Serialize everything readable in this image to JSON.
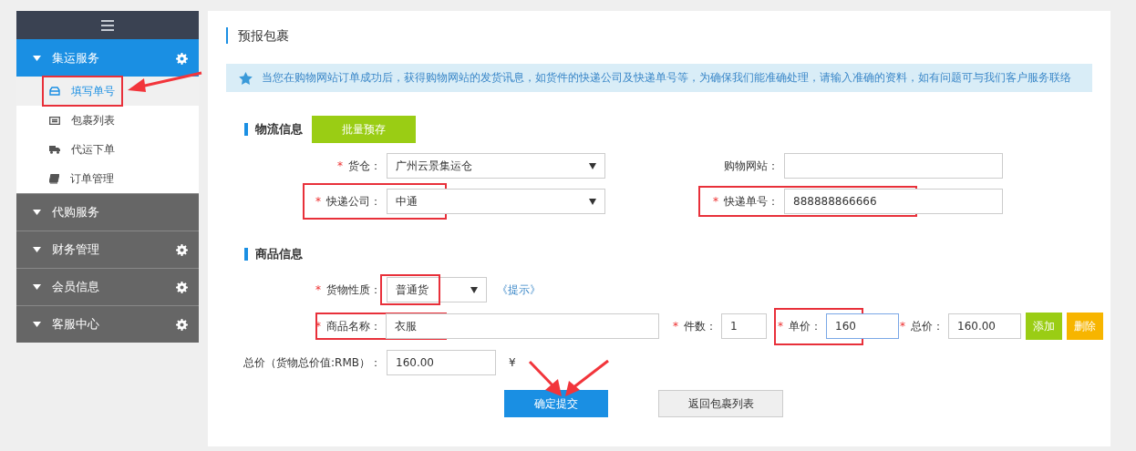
{
  "sidebar": {
    "sections": [
      {
        "label": "集运服务",
        "selected": true,
        "settings": true,
        "items": [
          {
            "label": "填写单号",
            "selected": true
          },
          {
            "label": "包裹列表",
            "selected": false
          },
          {
            "label": "代运下单",
            "selected": false
          },
          {
            "label": "订单管理",
            "selected": false
          }
        ]
      },
      {
        "label": "代购服务",
        "selected": false,
        "settings": false
      },
      {
        "label": "财务管理",
        "selected": false,
        "settings": true
      },
      {
        "label": "会员信息",
        "selected": false,
        "settings": true
      },
      {
        "label": "客服中心",
        "selected": false,
        "settings": true
      }
    ]
  },
  "page": {
    "title": "预报包裹",
    "notice": "当您在购物网站订单成功后，获得购物网站的发货讯息，如货件的快递公司及快递单号等，为确保我们能准确处理，请输入准确的资料，如有问题可与我们客户服务联络"
  },
  "logistics": {
    "heading": "物流信息",
    "batch_button": "批量预存",
    "fields": [
      {
        "label": "货仓：",
        "required_mark": "*",
        "kind": "select",
        "value": "广州云景集运仓"
      },
      {
        "label": "购物网站：",
        "kind": "input"
      },
      {
        "label": "快递公司：",
        "required_mark": "*",
        "kind": "select",
        "value": "中通"
      },
      {
        "label": "快递单号：",
        "required_mark": "*",
        "kind": "input",
        "value": "888888866666"
      }
    ]
  },
  "goods": {
    "heading": "商品信息",
    "nature": {
      "label": "货物性质：",
      "required_mark": "*",
      "value": "普通货",
      "hint_link": "《提示》"
    },
    "item_fields": [
      {
        "label": "商品名称：",
        "required_mark": "*",
        "value": "衣服",
        "focused": false
      },
      {
        "label": "件数：",
        "required_mark": "*",
        "value": "1",
        "focused": false
      },
      {
        "label": "单价：",
        "required_mark": "*",
        "value": "160",
        "focused": true
      },
      {
        "label": "总价：",
        "required_mark": "*",
        "value": "160.00",
        "focused": false
      }
    ],
    "add_button": "添加",
    "delete_button": "删除",
    "total": {
      "label": "总价（货物总价值:RMB）：",
      "value": "160.00",
      "currency": "¥"
    }
  },
  "actions": {
    "submit": "确定提交",
    "back": "返回包裹列表"
  }
}
